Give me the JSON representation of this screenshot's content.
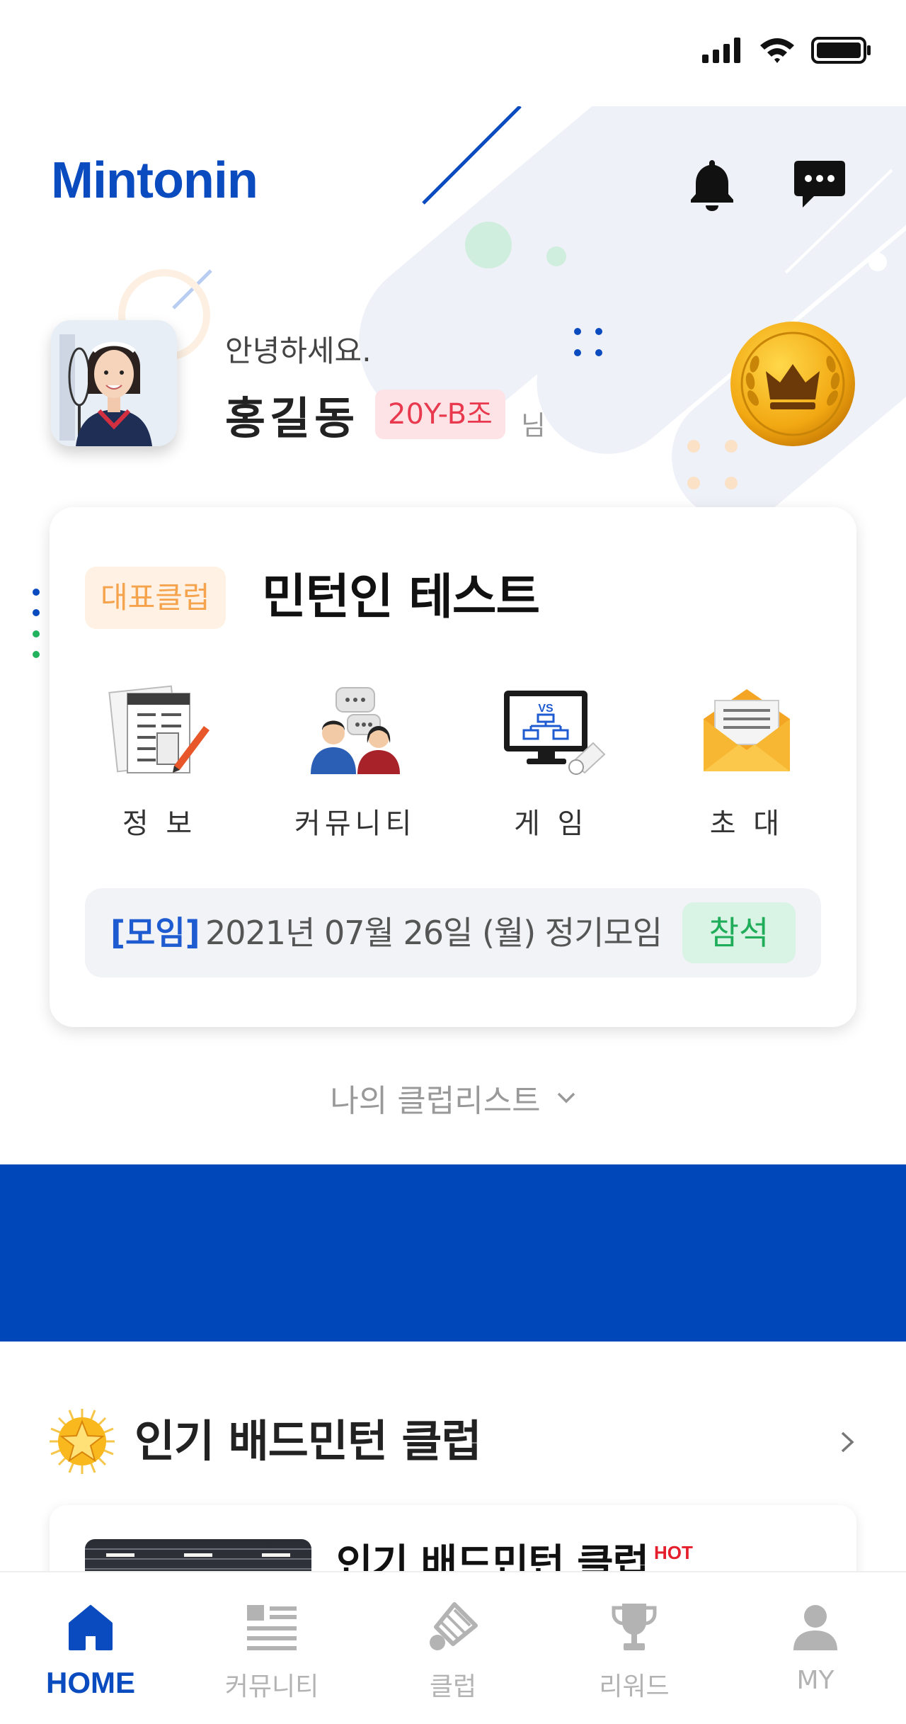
{
  "app": {
    "logo": "Mintonin"
  },
  "profile": {
    "greeting": "안녕하세요.",
    "name": "홍길동",
    "group": "20Y-B조",
    "honorific": "님"
  },
  "club_card": {
    "tag": "대표클럽",
    "name": "민턴인 테스트",
    "menu": [
      {
        "label": "정 보",
        "icon": "document-pen-icon"
      },
      {
        "label": "커뮤니티",
        "icon": "people-chat-icon"
      },
      {
        "label": "게 임",
        "icon": "game-bracket-monitor-icon"
      },
      {
        "label": "초 대",
        "icon": "envelope-icon"
      }
    ],
    "meeting": {
      "type": "[모임]",
      "text": "2021년 07월 26일 (월) 정기모임",
      "action": "참석"
    }
  },
  "club_list_toggle": "나의 클럽리스트",
  "popular": {
    "title": "인기 배드민턴 클럽",
    "card": {
      "name": "인기 배드민턴 클럽",
      "badge": "HOT"
    }
  },
  "tabbar": {
    "items": [
      {
        "label": "HOME",
        "icon": "home-icon",
        "active": true
      },
      {
        "label": "커뮤니티",
        "icon": "list-icon",
        "active": false
      },
      {
        "label": "클럽",
        "icon": "shuttlecock-icon",
        "active": false
      },
      {
        "label": "리워드",
        "icon": "trophy-icon",
        "active": false
      },
      {
        "label": "MY",
        "icon": "person-icon",
        "active": false
      }
    ]
  },
  "colors": {
    "brand": "#0a4bbf",
    "banner": "#0047ba",
    "group_badge_bg": "#fde3e6",
    "group_badge_text": "#e8394f",
    "club_tag_bg": "#fff1e3",
    "club_tag_text": "#f5a44d",
    "attend_bg": "#d9f3e4",
    "attend_text": "#1fad5a",
    "tab_inactive": "#b3b3b3"
  }
}
